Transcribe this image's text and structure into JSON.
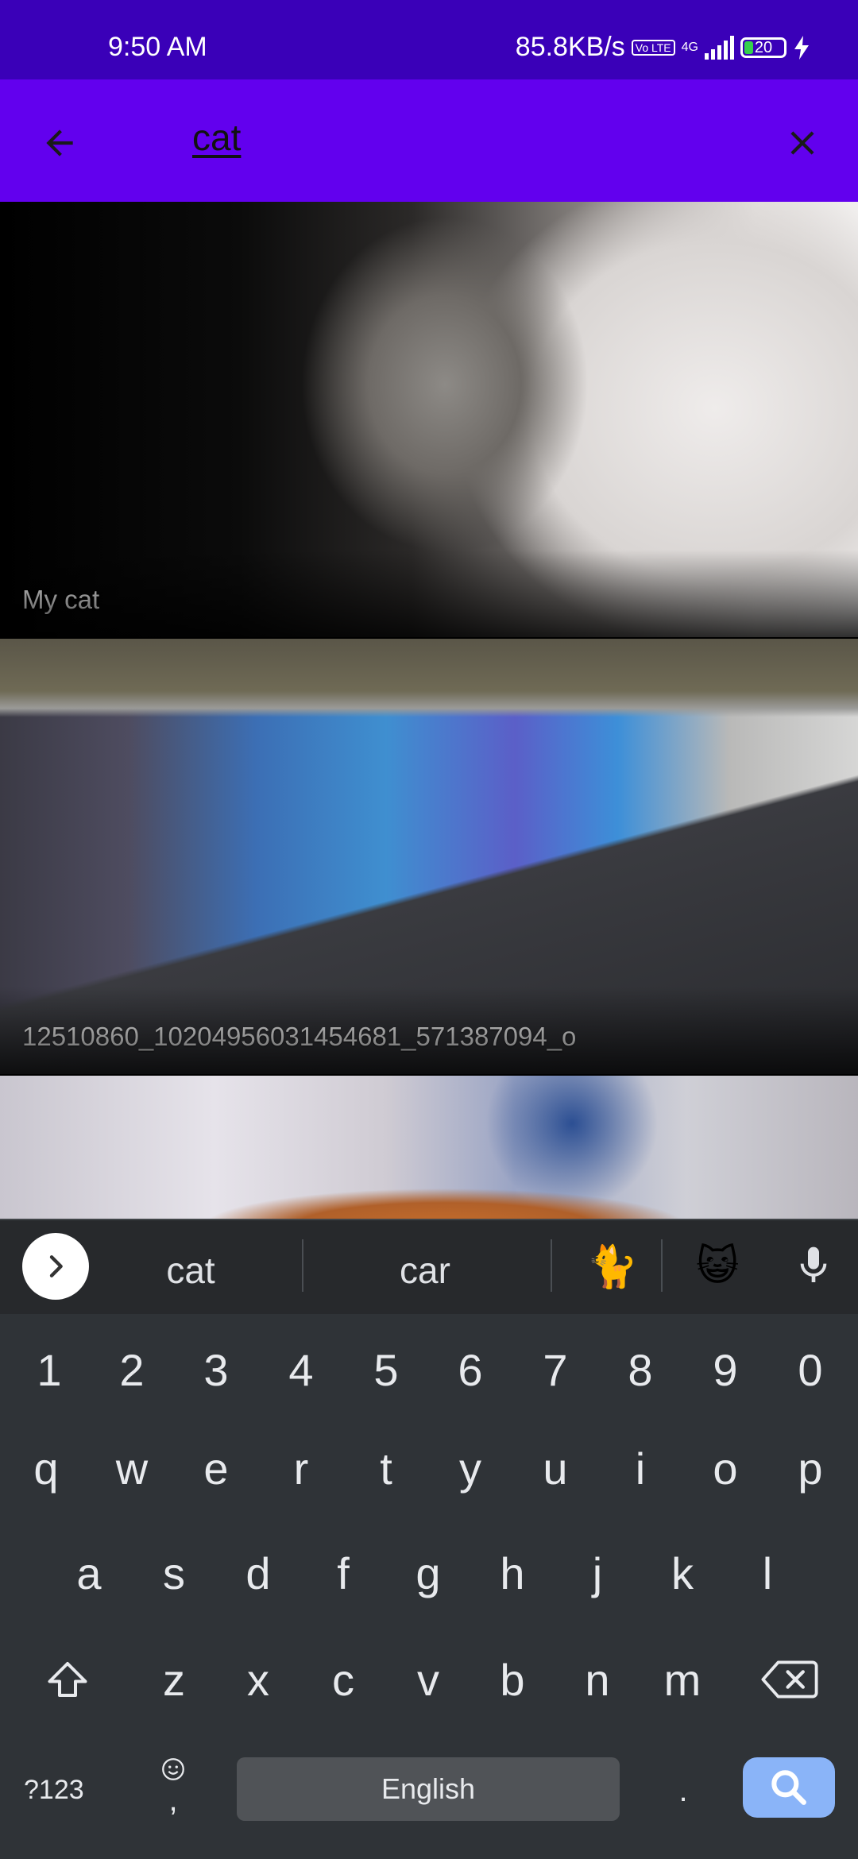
{
  "status_bar": {
    "time": "9:50 AM",
    "net_speed": "85.8KB/s",
    "volte": "Vo LTE",
    "network": "4G",
    "battery": "20"
  },
  "app_bar": {
    "query": "cat"
  },
  "results": [
    {
      "caption": "My cat"
    },
    {
      "caption": "12510860_10204956031454681_571387094_o"
    },
    {
      "caption": ""
    }
  ],
  "keyboard": {
    "suggestions": [
      "cat",
      "car"
    ],
    "emojis": [
      "🐈",
      "😺"
    ],
    "number_row": [
      "1",
      "2",
      "3",
      "4",
      "5",
      "6",
      "7",
      "8",
      "9",
      "0"
    ],
    "row1": [
      "q",
      "w",
      "e",
      "r",
      "t",
      "y",
      "u",
      "i",
      "o",
      "p"
    ],
    "row2": [
      "a",
      "s",
      "d",
      "f",
      "g",
      "h",
      "j",
      "k",
      "l"
    ],
    "row3": [
      "z",
      "x",
      "c",
      "v",
      "b",
      "n",
      "m"
    ],
    "symbols_label": "?123",
    "comma_label": ",",
    "period_label": ".",
    "space_label": "English"
  }
}
